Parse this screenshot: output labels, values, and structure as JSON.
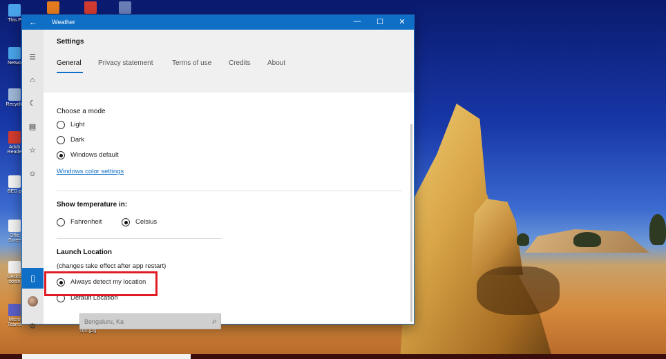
{
  "desktop": {
    "icons": [
      {
        "label": "This P",
        "icon": "computer-icon",
        "color": "#4aa3e8"
      },
      {
        "label": "Netwo",
        "icon": "network-icon",
        "color": "#4aa3e8"
      },
      {
        "label": "Recycle",
        "icon": "recycle-bin-icon",
        "color": "#9fb8d8"
      },
      {
        "label": "Adob Reade",
        "icon": "pdf-icon",
        "color": "#d23b2f"
      },
      {
        "label": "BED p",
        "icon": "file-icon",
        "color": "#f3f3f3"
      },
      {
        "label": "Offic Scree",
        "icon": "file-icon",
        "color": "#f3f3f3"
      },
      {
        "label": "Desktc conte",
        "icon": "file-icon",
        "color": "#f3f3f3"
      },
      {
        "label": "Micro Teams",
        "icon": "teams-icon",
        "color": "#5b5fc7"
      }
    ],
    "bottom_label": "hjn.jpg"
  },
  "window": {
    "title": "Weather",
    "back_glyph": "←",
    "minimize_glyph": "—",
    "maximize_glyph": "☐",
    "close_glyph": "✕",
    "header_title": "Settings",
    "tabs": [
      {
        "label": "General",
        "active": true
      },
      {
        "label": "Privacy statement",
        "active": false
      },
      {
        "label": "Terms of use",
        "active": false
      },
      {
        "label": "Credits",
        "active": false
      },
      {
        "label": "About",
        "active": false
      }
    ],
    "nav_icons": [
      "hamburger-icon",
      "home-icon",
      "forecast-icon",
      "historical-weather-icon",
      "favorites-icon",
      "feedback-icon"
    ],
    "nav_glyphs": {
      "hamburger": "☰",
      "home": "⌂",
      "forecast": "☾",
      "history": "▤",
      "favorites": "☆",
      "feedback": "☺",
      "phone": "▯",
      "settings": "⚙"
    },
    "mode": {
      "title": "Choose a mode",
      "options": [
        {
          "label": "Light",
          "checked": false
        },
        {
          "label": "Dark",
          "checked": false
        },
        {
          "label": "Windows default",
          "checked": true
        }
      ],
      "link": "Windows color settings"
    },
    "temperature": {
      "title": "Show temperature in:",
      "options": [
        {
          "label": "Fahrenheit",
          "checked": false
        },
        {
          "label": "Celsius",
          "checked": true
        }
      ]
    },
    "launch": {
      "title": "Launch Location",
      "subtitle": "(changes take effect after app restart)",
      "options": [
        {
          "label": "Always detect my location",
          "checked": true
        },
        {
          "label": "Default Location",
          "checked": false
        }
      ],
      "location_value": "Bengaluru, Ka"
    }
  }
}
